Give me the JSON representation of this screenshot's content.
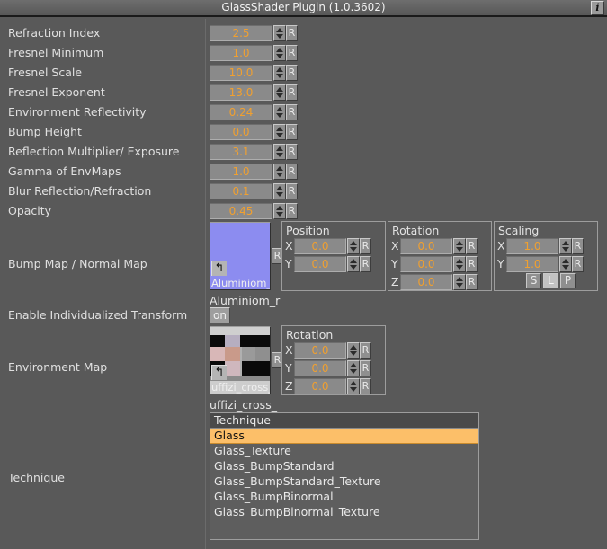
{
  "window": {
    "title": "GlassShader Plugin (1.0.3602)",
    "info_button": "i",
    "info_icon_name": "info-icon"
  },
  "params": [
    {
      "label": "Refraction Index",
      "value": "2.5",
      "reset": "R"
    },
    {
      "label": "Fresnel Minimum",
      "value": "1.0",
      "reset": "R"
    },
    {
      "label": "Fresnel Scale",
      "value": "10.0",
      "reset": "R"
    },
    {
      "label": "Fresnel Exponent",
      "value": "13.0",
      "reset": "R"
    },
    {
      "label": "Environment Reflectivity",
      "value": "0.24",
      "reset": "R"
    },
    {
      "label": "Bump Height",
      "value": "0.0",
      "reset": "R"
    },
    {
      "label": "Reflection Multiplier/ Exposure",
      "value": "3.1",
      "reset": "R"
    },
    {
      "label": "Gamma of EnvMaps",
      "value": "1.0",
      "reset": "R"
    },
    {
      "label": "Blur Reflection/Refraction",
      "value": "0.1",
      "reset": "R"
    },
    {
      "label": "Opacity",
      "value": "0.45",
      "reset": "R"
    }
  ],
  "bump_map": {
    "label": "Bump Map / Normal Map",
    "texture_caption": "Aluminiom_r",
    "texture_name": "Aluminiom_r",
    "texture_color": "#8c8cf0",
    "browse_icon": "↰",
    "reset": "R",
    "position": {
      "title": "Position",
      "axes": [
        {
          "axis": "X",
          "value": "0.0",
          "reset": "R"
        },
        {
          "axis": "Y",
          "value": "0.0",
          "reset": "R"
        }
      ]
    },
    "rotation": {
      "title": "Rotation",
      "axes": [
        {
          "axis": "X",
          "value": "0.0",
          "reset": "R"
        },
        {
          "axis": "Y",
          "value": "0.0",
          "reset": "R"
        },
        {
          "axis": "Z",
          "value": "0.0",
          "reset": "R"
        }
      ]
    },
    "scaling": {
      "title": "Scaling",
      "axes": [
        {
          "axis": "X",
          "value": "1.0",
          "reset": "R"
        },
        {
          "axis": "Y",
          "value": "1.0",
          "reset": "R"
        }
      ],
      "modes": [
        {
          "label": "S",
          "active": false
        },
        {
          "label": "L",
          "active": true
        },
        {
          "label": "P",
          "active": false
        }
      ]
    }
  },
  "individualized_transform": {
    "label": "Enable Individualized Transform",
    "value": "on"
  },
  "environment_map": {
    "label": "Environment Map",
    "texture_caption": "uffizi_cross_",
    "texture_name": "uffizi_cross_",
    "browse_icon": "↰",
    "reset": "R",
    "rotation": {
      "title": "Rotation",
      "axes": [
        {
          "axis": "X",
          "value": "0.0",
          "reset": "R"
        },
        {
          "axis": "Y",
          "value": "0.0",
          "reset": "R"
        },
        {
          "axis": "Z",
          "value": "0.0",
          "reset": "R"
        }
      ]
    }
  },
  "technique": {
    "label": "Technique",
    "header": "Technique",
    "selected": "Glass",
    "items": [
      "Glass",
      "Glass_Texture",
      "Glass_BumpStandard",
      "Glass_BumpStandard_Texture",
      "Glass_BumpBinormal",
      "Glass_BumpBinormal_Texture"
    ]
  },
  "colors": {
    "background": "#595959",
    "value_text": "#f0a030",
    "field_bg": "#8a8a8a",
    "selection": "#fcbf69"
  }
}
